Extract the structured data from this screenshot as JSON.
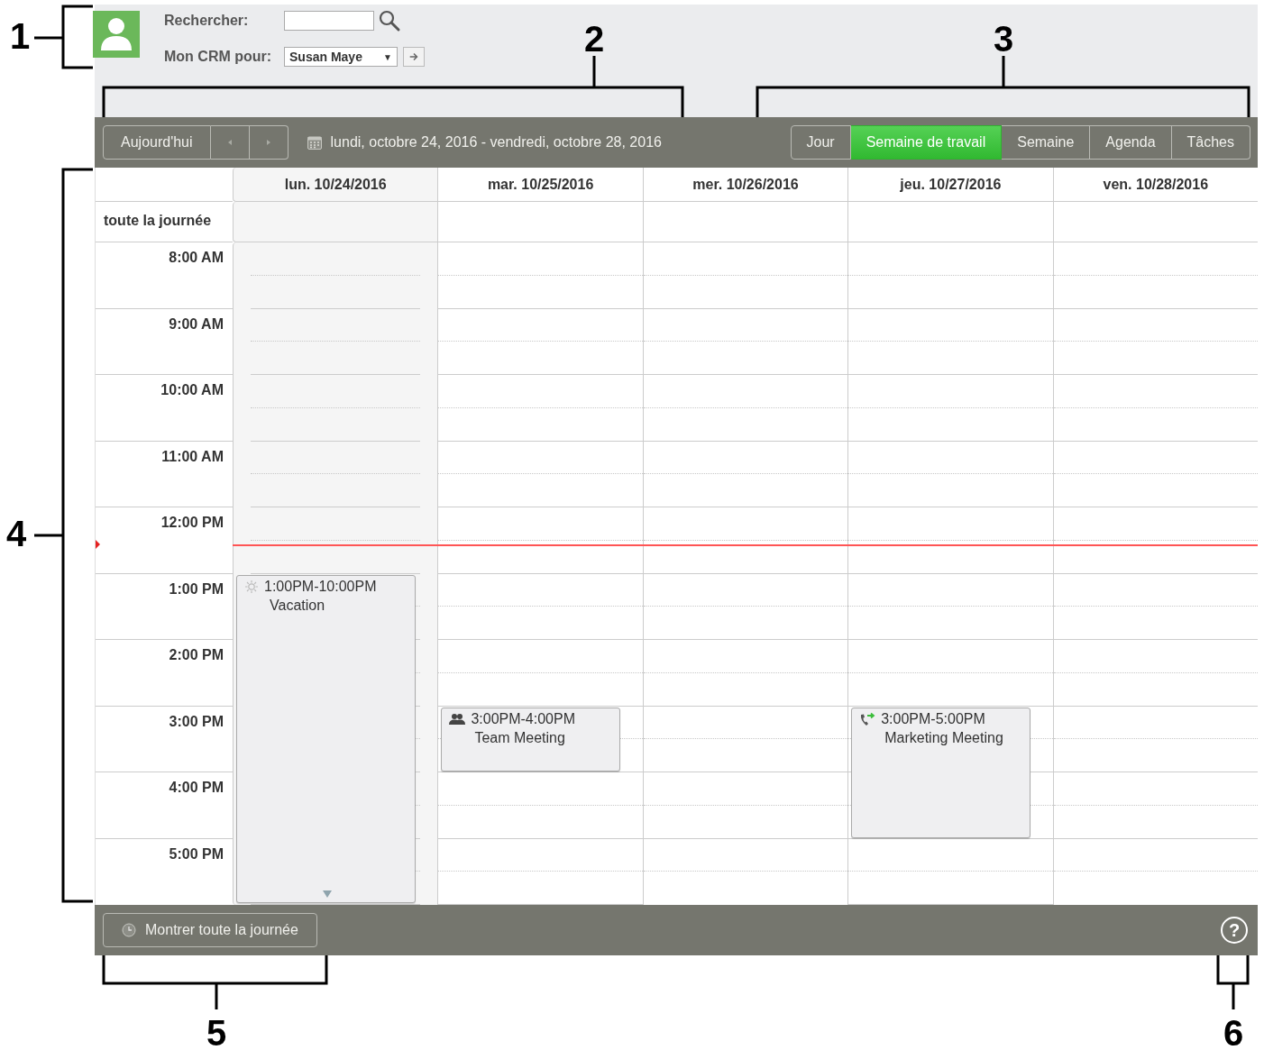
{
  "header": {
    "search_label": "Rechercher:",
    "crm_label": "Mon CRM pour:",
    "crm_user": "Susan Maye",
    "dropdown_arrow": "▼"
  },
  "toolbar": {
    "today_button": "Aujourd'hui",
    "date_range": "lundi, octobre 24, 2016 - vendredi, octobre 28, 2016",
    "views": [
      {
        "label": "Jour",
        "selected": false
      },
      {
        "label": "Semaine de travail",
        "selected": true
      },
      {
        "label": "Semaine",
        "selected": false
      },
      {
        "label": "Agenda",
        "selected": false
      },
      {
        "label": "Tâches",
        "selected": false
      }
    ]
  },
  "grid": {
    "all_day_label": "toute la journée",
    "hours": [
      "8:00 AM",
      "9:00 AM",
      "10:00 AM",
      "11:00 AM",
      "12:00 PM",
      "1:00 PM",
      "2:00 PM",
      "3:00 PM",
      "4:00 PM",
      "5:00 PM"
    ],
    "days": [
      {
        "label": "lun. 10/24/2016",
        "today": true,
        "events": [
          {
            "kind": "vacation",
            "time": "1:00PM-10:00PM",
            "title": "Vacation",
            "continues": true
          }
        ]
      },
      {
        "label": "mar. 10/25/2016",
        "today": false,
        "events": [
          {
            "kind": "meeting",
            "time": "3:00PM-4:00PM",
            "title": "Team Meeting",
            "continues": false
          }
        ]
      },
      {
        "label": "mer. 10/26/2016",
        "today": false
      },
      {
        "label": "jeu. 10/27/2016",
        "today": false,
        "events": [
          {
            "kind": "call",
            "time": "3:00PM-5:00PM",
            "title": "Marketing Meeting",
            "continues": false
          }
        ]
      },
      {
        "label": "ven. 10/28/2016",
        "today": false
      }
    ]
  },
  "footer": {
    "show_all_button": "Montrer toute la journée",
    "help": "?"
  },
  "callouts": [
    "1",
    "2",
    "3",
    "4",
    "5",
    "6"
  ]
}
